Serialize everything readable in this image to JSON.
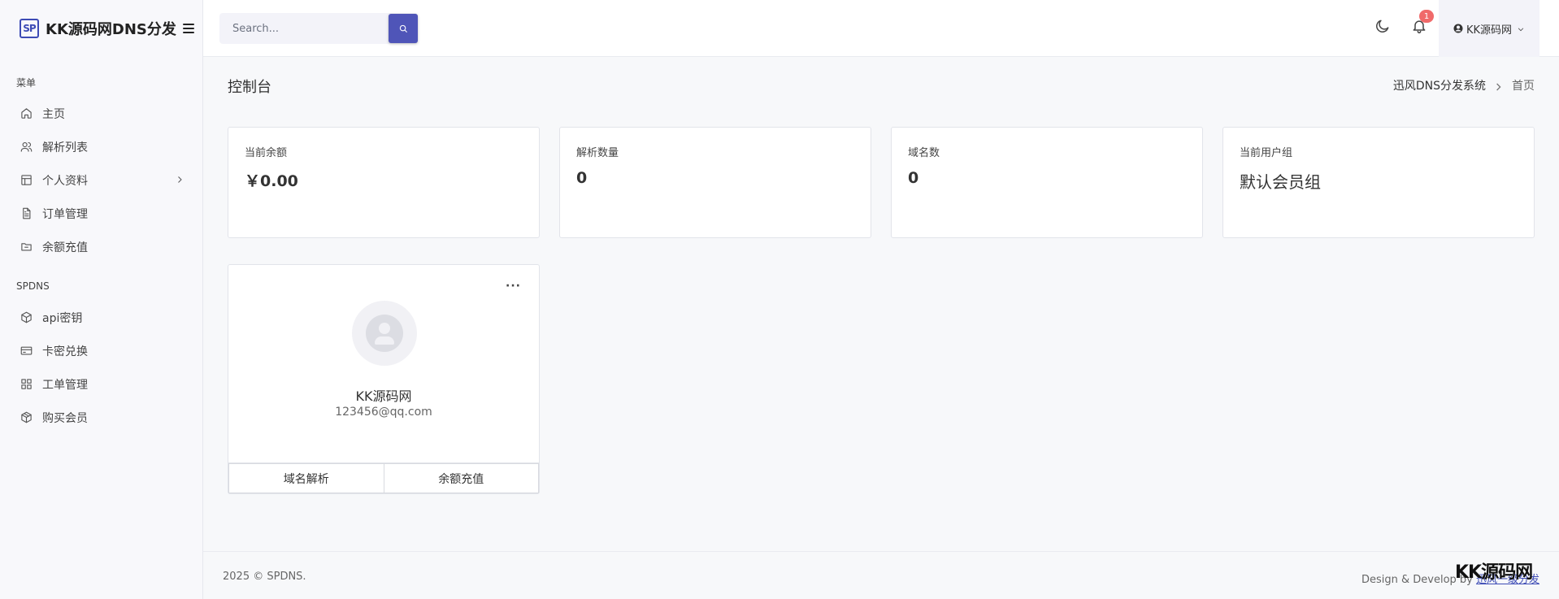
{
  "brand": {
    "logo_text": "SP",
    "name": "KK源码网DNS分发"
  },
  "sidebar": {
    "section1_title": "菜单",
    "section1_items": [
      {
        "label": "主页",
        "icon": "home-icon"
      },
      {
        "label": "解析列表",
        "icon": "users-icon"
      },
      {
        "label": "个人资料",
        "icon": "layout-icon",
        "has_submenu": true
      },
      {
        "label": "订单管理",
        "icon": "file-icon"
      },
      {
        "label": "余额充值",
        "icon": "folder-icon"
      }
    ],
    "section2_title": "SPDNS",
    "section2_items": [
      {
        "label": "api密钥",
        "icon": "cube-icon"
      },
      {
        "label": "卡密兑换",
        "icon": "credit-card-icon"
      },
      {
        "label": "工单管理",
        "icon": "grid-icon"
      },
      {
        "label": "购买会员",
        "icon": "box-icon"
      }
    ]
  },
  "topbar": {
    "search_placeholder": "Search...",
    "notification_count": "1",
    "username": "KK源码网"
  },
  "page": {
    "title": "控制台",
    "breadcrumb": [
      "迅风DNS分发系统",
      "首页"
    ]
  },
  "stats": [
    {
      "label": "当前余额",
      "value": "￥0.00"
    },
    {
      "label": "解析数量",
      "value": "0"
    },
    {
      "label": "域名数",
      "value": "0"
    },
    {
      "label": "当前用户组",
      "value": "默认会员组"
    }
  ],
  "profile": {
    "menu": "···",
    "name": "KK源码网",
    "email": "123456@qq.com",
    "actions": [
      "域名解析",
      "余额充值"
    ]
  },
  "footer": {
    "copyright": "2025 © SPDNS.",
    "credit_prefix": "Design & Develop by ",
    "credit_link": "迅风一级分发"
  },
  "watermark": "KK源码网",
  "colors": {
    "accent": "#4f55b8",
    "badge": "#f06a6a"
  }
}
